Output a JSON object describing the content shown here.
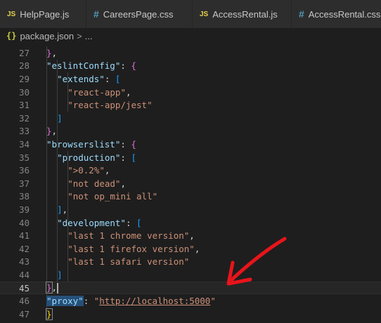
{
  "tabs": [
    {
      "icon": "JS",
      "label": "HelpPage.js",
      "type": "js"
    },
    {
      "icon": "#",
      "label": "CareersPage.css",
      "type": "css"
    },
    {
      "icon": "JS",
      "label": "AccessRental.js",
      "type": "js"
    },
    {
      "icon": "#",
      "label": "AccessRental.css",
      "type": "css"
    }
  ],
  "breadcrumb": {
    "icon": "{}",
    "file": "package.json",
    "separator": ">",
    "rest": "..."
  },
  "editor": {
    "active_line": 45,
    "lines": [
      {
        "n": "27",
        "t": "},"
      },
      {
        "n": "28",
        "t": "\"eslintConfig\": {"
      },
      {
        "n": "29",
        "t": "\"extends\": ["
      },
      {
        "n": "30",
        "t": "\"react-app\","
      },
      {
        "n": "31",
        "t": "\"react-app/jest\""
      },
      {
        "n": "32",
        "t": "]"
      },
      {
        "n": "33",
        "t": "},"
      },
      {
        "n": "34",
        "t": "\"browserslist\": {"
      },
      {
        "n": "35",
        "t": "\"production\": ["
      },
      {
        "n": "36",
        "t": "\">0.2%\","
      },
      {
        "n": "37",
        "t": "\"not dead\","
      },
      {
        "n": "38",
        "t": "\"not op_mini all\""
      },
      {
        "n": "39",
        "t": "],"
      },
      {
        "n": "40",
        "t": "\"development\": ["
      },
      {
        "n": "41",
        "t": "\"last 1 chrome version\","
      },
      {
        "n": "42",
        "t": "\"last 1 firefox version\","
      },
      {
        "n": "43",
        "t": "\"last 1 safari version\""
      },
      {
        "n": "44",
        "t": "]"
      },
      {
        "n": "45",
        "t": "},"
      },
      {
        "n": "46",
        "t": "\"proxy\": \"http://localhost:5000\""
      },
      {
        "n": "47",
        "t": "}"
      }
    ]
  },
  "colors": {
    "background": "#1e1e1e",
    "key": "#9cdcfe",
    "string": "#ce9178",
    "annotation_arrow": "#e8141b"
  },
  "annotation": {
    "icon": "red-arrow-icon"
  }
}
